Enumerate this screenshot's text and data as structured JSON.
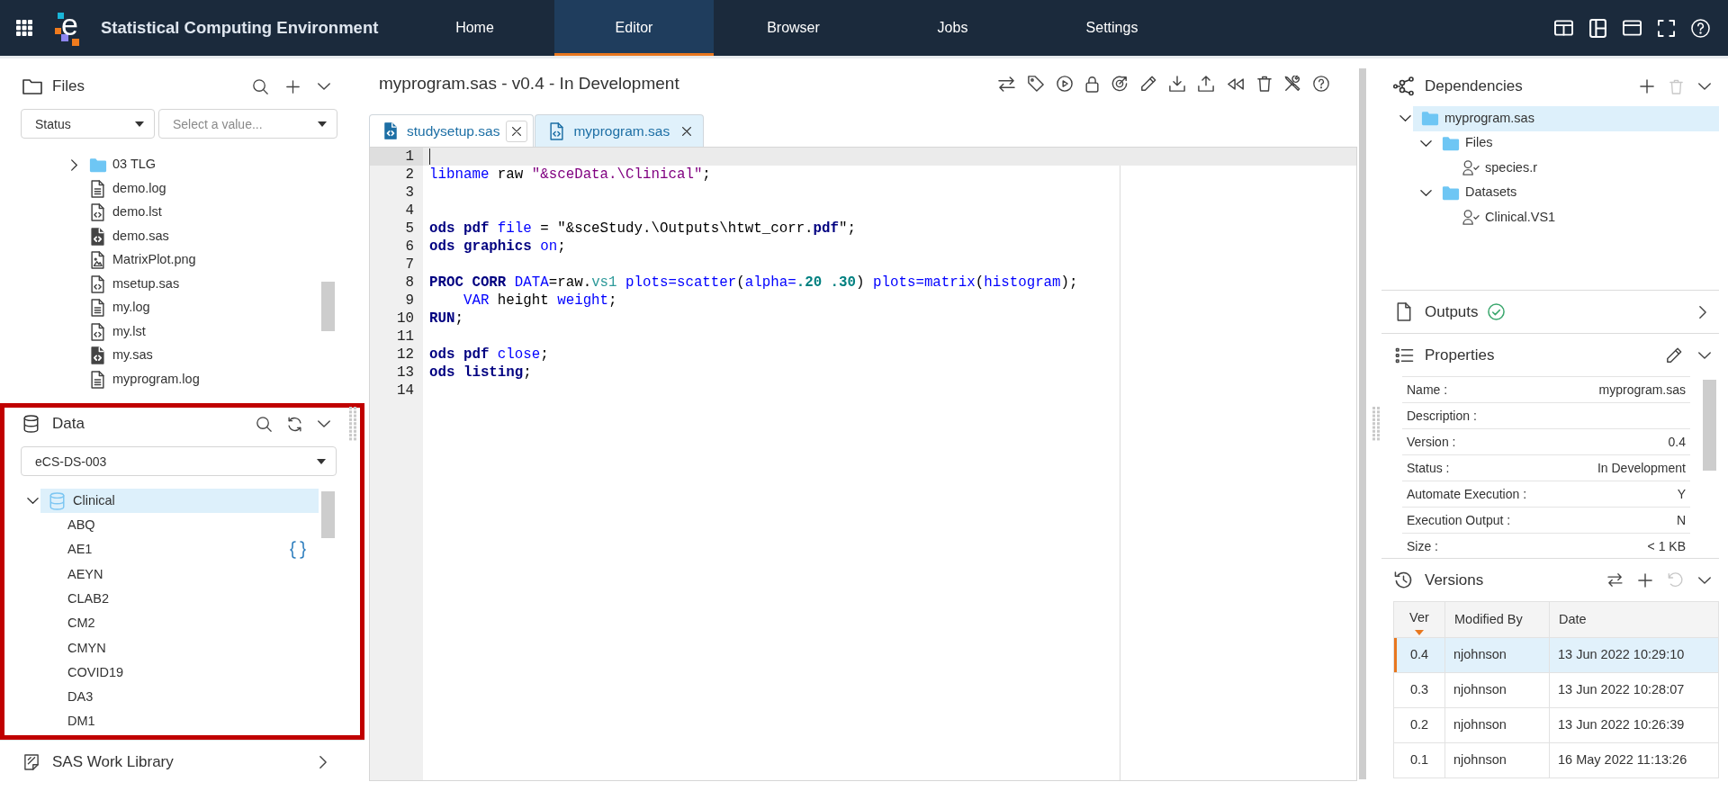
{
  "navbar": {
    "logo_letter": "e",
    "title": "Statistical Computing Environment",
    "tabs": [
      {
        "label": "Home",
        "selected": false
      },
      {
        "label": "Editor",
        "selected": true
      },
      {
        "label": "Browser",
        "selected": false
      },
      {
        "label": "Jobs",
        "selected": false
      },
      {
        "label": "Settings",
        "selected": false
      }
    ]
  },
  "files_panel": {
    "title": "Files",
    "filters": [
      {
        "value": "Status"
      },
      {
        "placeholder": "Select a value..."
      }
    ],
    "items": [
      {
        "label": "03 TLG",
        "kind": "folder",
        "expanded": false,
        "selected": false
      },
      {
        "label": "demo.log",
        "kind": "text",
        "selected": false
      },
      {
        "label": "demo.lst",
        "kind": "code",
        "selected": false
      },
      {
        "label": "demo.sas",
        "kind": "program",
        "selected": false
      },
      {
        "label": "MatrixPlot.png",
        "kind": "image",
        "selected": false
      },
      {
        "label": "msetup.sas",
        "kind": "code",
        "selected": false
      },
      {
        "label": "my.log",
        "kind": "text",
        "selected": false
      },
      {
        "label": "my.lst",
        "kind": "code",
        "selected": false
      },
      {
        "label": "my.sas",
        "kind": "program",
        "selected": false
      },
      {
        "label": "myprogram.log",
        "kind": "text",
        "selected": false
      }
    ]
  },
  "data_panel": {
    "title": "Data",
    "highlighted": true,
    "library": "eCS-DS-003",
    "tree": [
      {
        "label": "Clinical",
        "expanded": true,
        "selected": true,
        "children": [
          {
            "label": "ABQ",
            "selected": false,
            "hovered": false
          },
          {
            "label": "AE1",
            "selected": false,
            "hovered": true
          },
          {
            "label": "AEYN",
            "selected": false,
            "hovered": false
          },
          {
            "label": "CLAB2",
            "selected": false,
            "hovered": false
          },
          {
            "label": "CM2",
            "selected": false,
            "hovered": false
          },
          {
            "label": "CMYN",
            "selected": false,
            "hovered": false
          },
          {
            "label": "COVID19",
            "selected": false,
            "hovered": false
          },
          {
            "label": "DA3",
            "selected": false,
            "hovered": false
          },
          {
            "label": "DM1",
            "selected": false,
            "hovered": false
          }
        ]
      }
    ]
  },
  "work_library": {
    "title": "SAS Work Library"
  },
  "editor": {
    "title": "myprogram.sas - v0.4 - In Development",
    "tabs": [
      {
        "label": "studysetup.sas",
        "kind": "program",
        "selected": false,
        "close_hovered": true
      },
      {
        "label": "myprogram.sas",
        "kind": "code",
        "selected": true,
        "close_hovered": false
      }
    ],
    "lines": [
      {
        "number": "1",
        "active": true
      },
      {
        "number": "2",
        "active": false,
        "tokens": [
          {
            "text": "libname",
            "kind": "keyword"
          },
          {
            "text": " raw ",
            "kind": "plain"
          },
          {
            "text": "\"&sceData.\\Clinical\"",
            "kind": "string"
          },
          {
            "text": ";",
            "kind": "plain"
          }
        ]
      },
      {
        "number": "3",
        "active": false
      },
      {
        "number": "4",
        "active": false
      },
      {
        "number": "5",
        "active": false,
        "tokens": [
          {
            "text": "ods pdf ",
            "kind": "statement"
          },
          {
            "text": "file",
            "kind": "keyword"
          },
          {
            "text": " = \"&sceStudy.\\Outputs\\htwt_corr.",
            "kind": "plain"
          },
          {
            "text": "pdf",
            "kind": "statement"
          },
          {
            "text": "\";",
            "kind": "plain"
          }
        ]
      },
      {
        "number": "6",
        "active": false,
        "tokens": [
          {
            "text": "ods graphics ",
            "kind": "statement"
          },
          {
            "text": "on",
            "kind": "keyword"
          },
          {
            "text": ";",
            "kind": "plain"
          }
        ]
      },
      {
        "number": "7",
        "active": false
      },
      {
        "number": "8",
        "active": false,
        "tokens": [
          {
            "text": "PROC CORR ",
            "kind": "statement"
          },
          {
            "text": "DATA",
            "kind": "keyword"
          },
          {
            "text": "=raw.",
            "kind": "plain"
          },
          {
            "text": "vs1 ",
            "kind": "dataset"
          },
          {
            "text": "plots=scatter",
            "kind": "keyword"
          },
          {
            "text": "(",
            "kind": "plain"
          },
          {
            "text": "alpha=",
            "kind": "keyword"
          },
          {
            "text": ".20 .30",
            "kind": "number"
          },
          {
            "text": ") ",
            "kind": "plain"
          },
          {
            "text": "plots=matrix",
            "kind": "keyword"
          },
          {
            "text": "(",
            "kind": "plain"
          },
          {
            "text": "histogram",
            "kind": "keyword"
          },
          {
            "text": ");",
            "kind": "plain"
          }
        ]
      },
      {
        "number": "9",
        "active": false,
        "tokens": [
          {
            "text": "    VAR",
            "kind": "keyword"
          },
          {
            "text": " height ",
            "kind": "plain"
          },
          {
            "text": "weight",
            "kind": "keyword"
          },
          {
            "text": ";",
            "kind": "plain"
          }
        ]
      },
      {
        "number": "10",
        "active": false,
        "tokens": [
          {
            "text": "RUN",
            "kind": "statement"
          },
          {
            "text": ";",
            "kind": "plain"
          }
        ]
      },
      {
        "number": "11",
        "active": false
      },
      {
        "number": "12",
        "active": false,
        "tokens": [
          {
            "text": "ods pdf ",
            "kind": "statement"
          },
          {
            "text": "close",
            "kind": "keyword"
          },
          {
            "text": ";",
            "kind": "plain"
          }
        ]
      },
      {
        "number": "13",
        "active": false,
        "tokens": [
          {
            "text": "ods listing",
            "kind": "statement"
          },
          {
            "text": ";",
            "kind": "plain"
          }
        ]
      },
      {
        "number": "14",
        "active": false
      }
    ]
  },
  "dependencies": {
    "title": "Dependencies",
    "actions": [
      {
        "kind": "add",
        "disabled": false
      },
      {
        "kind": "delete",
        "disabled": true
      }
    ],
    "tree": [
      {
        "label": "myprogram.sas",
        "kind": "folder",
        "expanded": true,
        "selected": true,
        "children": [
          {
            "label": "Files",
            "kind": "folder",
            "expanded": true,
            "selected": false,
            "children": [
              {
                "label": "species.r",
                "kind": "user",
                "selected": false
              }
            ]
          },
          {
            "label": "Datasets",
            "kind": "folder",
            "expanded": true,
            "selected": false,
            "children": [
              {
                "label": "Clinical.VS1",
                "kind": "user",
                "selected": false
              }
            ]
          }
        ]
      }
    ]
  },
  "outputs": {
    "title": "Outputs",
    "complete": true
  },
  "properties": {
    "title": "Properties",
    "rows": [
      {
        "label": "Name :",
        "value": "myprogram.sas"
      },
      {
        "label": "Description :"
      },
      {
        "label": "Version :",
        "value": "0.4"
      },
      {
        "label": "Status :",
        "value": "In Development"
      },
      {
        "label": "Automate Execution :",
        "value": "Y"
      },
      {
        "label": "Execution Output :",
        "value": "N"
      },
      {
        "label": "Size :",
        "value": "< 1 KB"
      }
    ]
  },
  "versions": {
    "title": "Versions",
    "actions": [
      {
        "kind": "compare",
        "disabled": false
      },
      {
        "kind": "add",
        "disabled": false
      },
      {
        "kind": "undo",
        "disabled": true
      }
    ],
    "columns": [
      {
        "label": "Ver",
        "sorted": true
      },
      {
        "label": "Modified By",
        "sorted": false
      },
      {
        "label": "Date",
        "sorted": false
      }
    ],
    "rows": [
      {
        "cells": [
          "0.4",
          "njohnson",
          "13 Jun 2022 10:29:10"
        ],
        "selected": true
      },
      {
        "cells": [
          "0.3",
          "njohnson",
          "13 Jun 2022 10:28:07"
        ],
        "selected": false
      },
      {
        "cells": [
          "0.2",
          "njohnson",
          "13 Jun 2022 10:26:39"
        ],
        "selected": false
      },
      {
        "cells": [
          "0.1",
          "njohnson",
          "16 May 2022 11:13:26"
        ],
        "selected": false
      }
    ]
  }
}
